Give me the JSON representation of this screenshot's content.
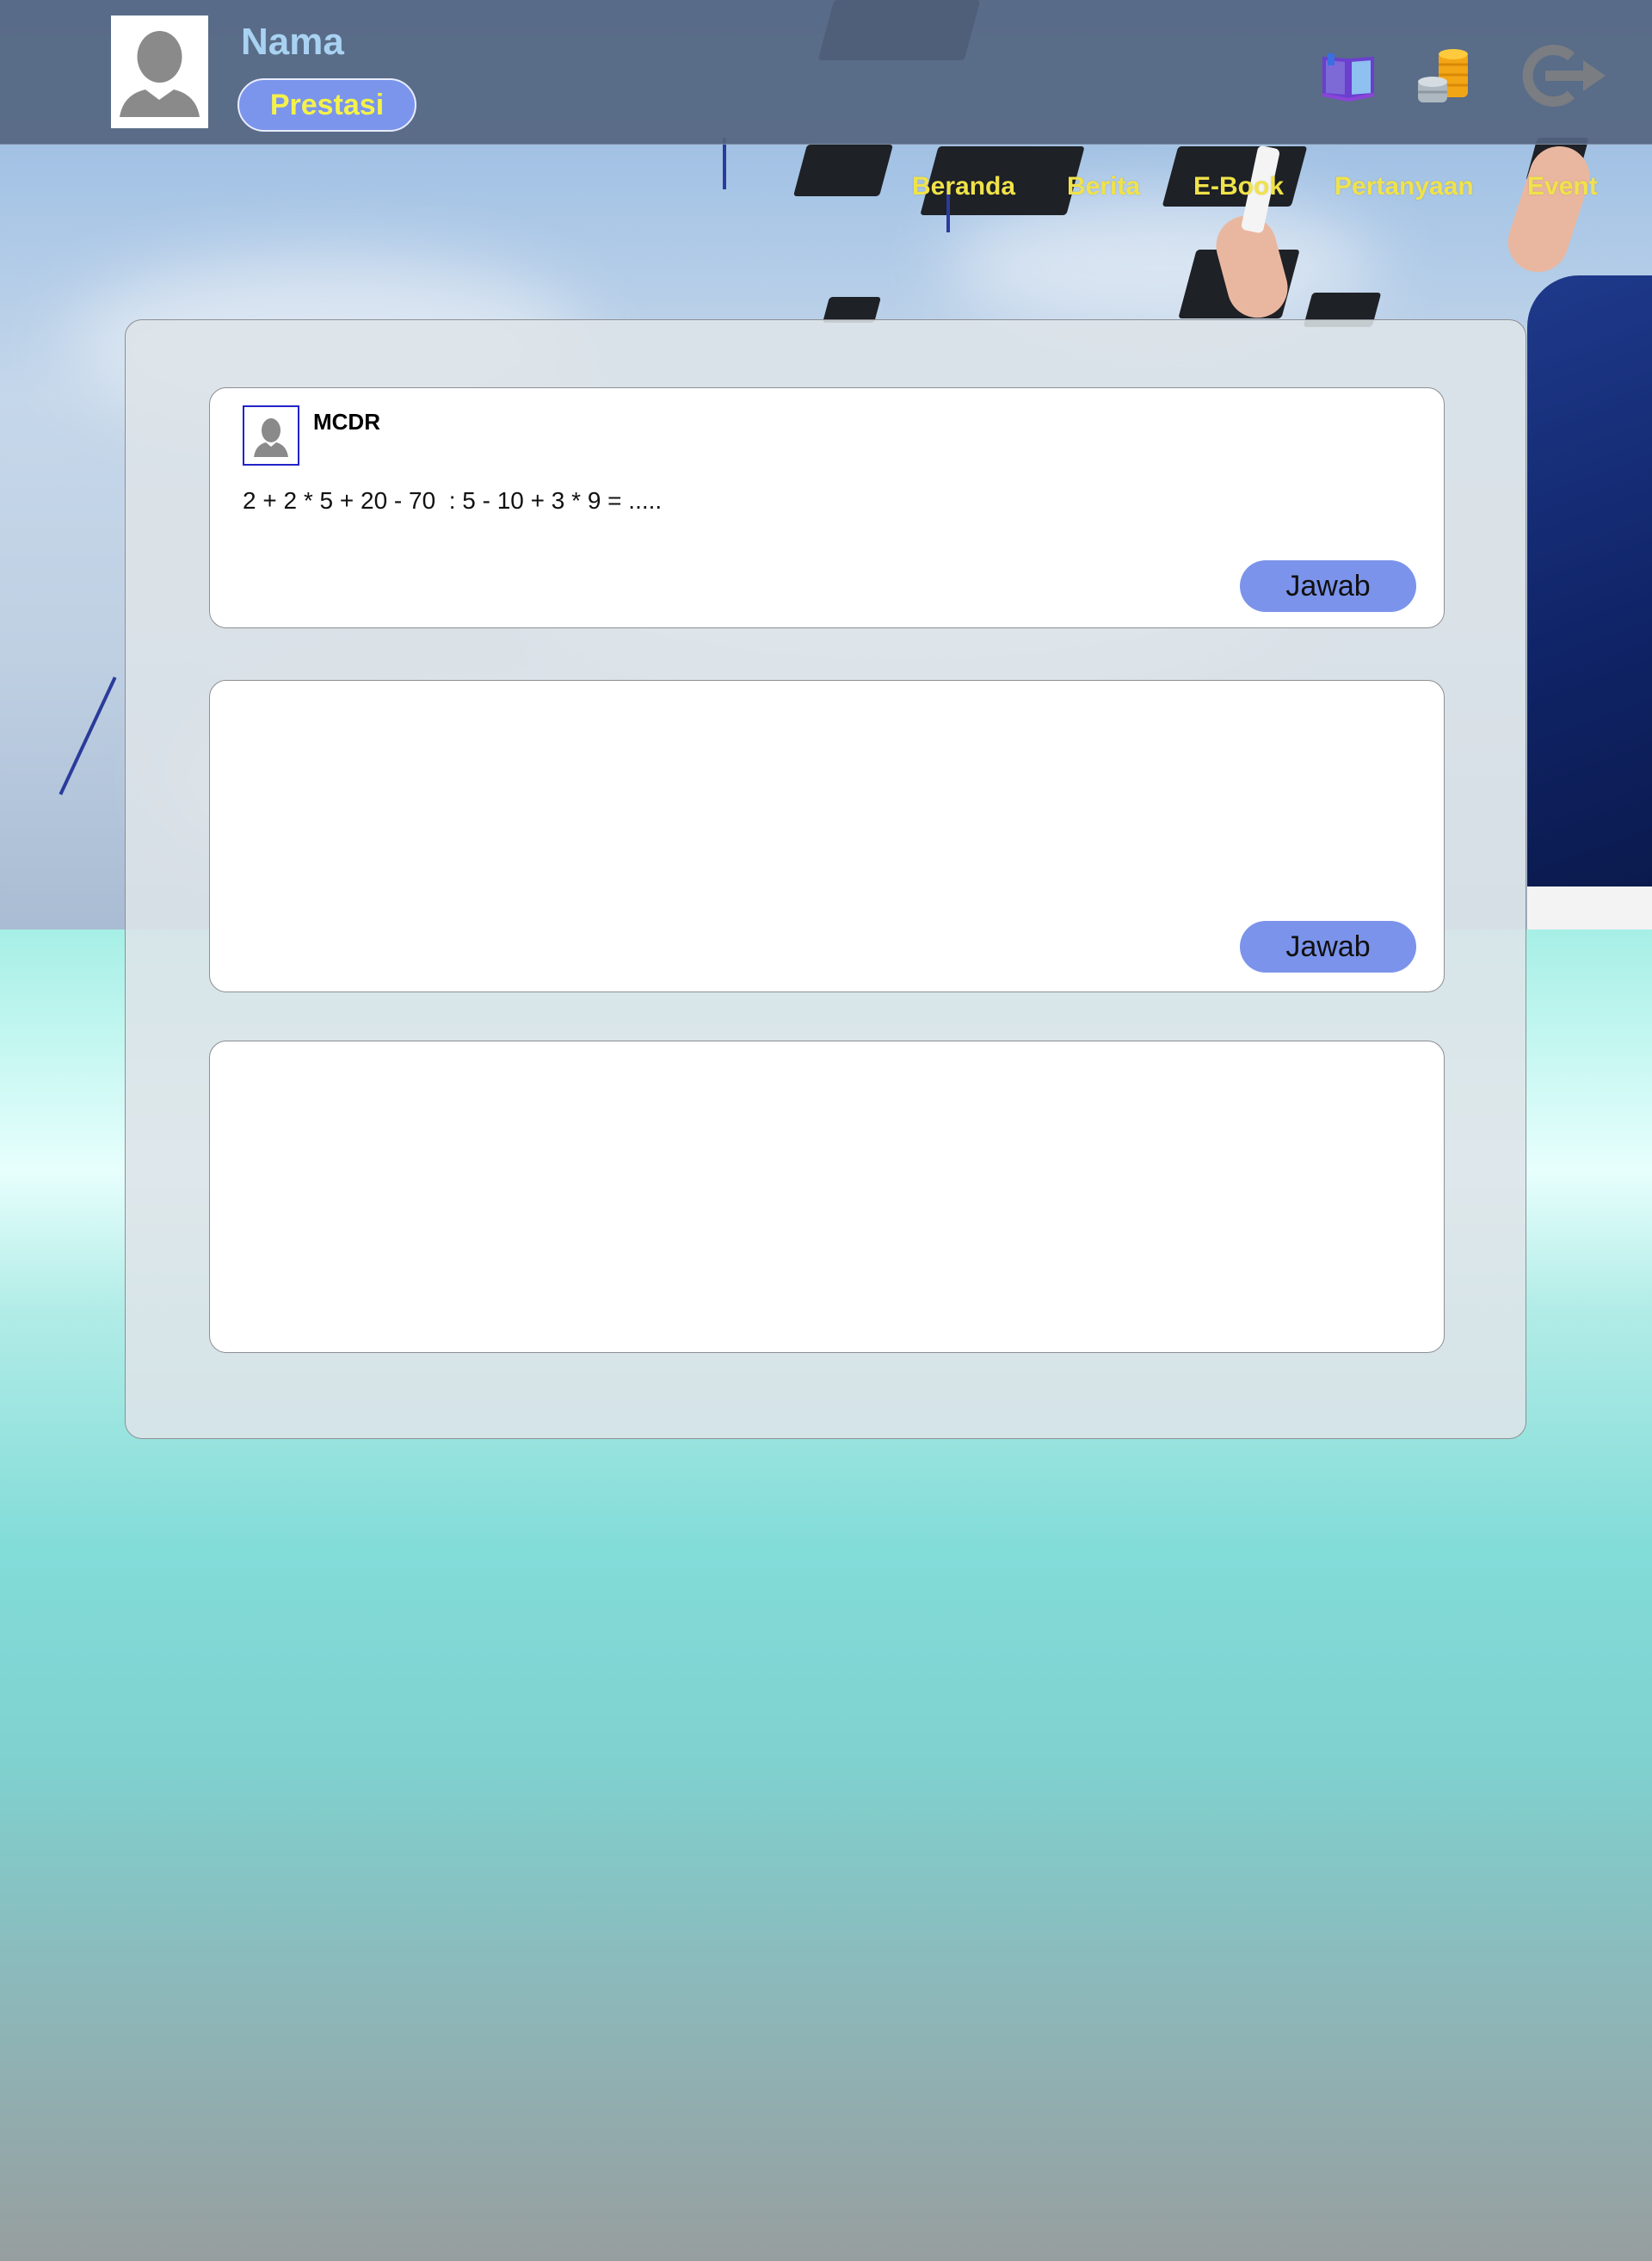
{
  "header": {
    "user_name": "Nama",
    "prestasi_label": "Prestasi",
    "icons": [
      "book-icon",
      "coins-icon",
      "logout-icon"
    ]
  },
  "nav": {
    "items": [
      "Beranda",
      "Berita",
      "E-Book",
      "Pertanyaan",
      "Event"
    ]
  },
  "questions": [
    {
      "user": "MCDR",
      "text": "2 + 2 * 5 + 20 - 70  : 5 - 10 + 3 * 9 = .....",
      "answer_label": "Jawab"
    },
    {
      "user": "",
      "text": "",
      "answer_label": "Jawab"
    },
    {
      "user": "",
      "text": ""
    }
  ],
  "colors": {
    "header_bg": "#546580",
    "accent_button": "#7b95ec",
    "nav_text": "#f0e24a",
    "name_text": "#a9d2f2"
  }
}
